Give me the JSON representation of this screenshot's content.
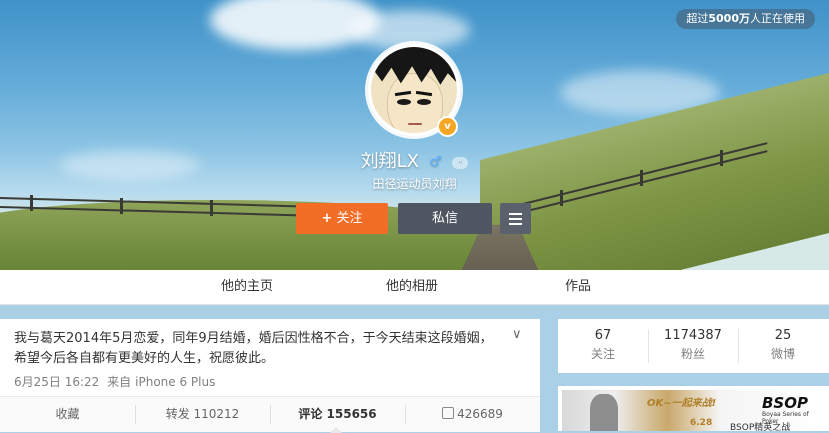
{
  "banner": {
    "usage_prefix": "超过",
    "usage_number": "5000万",
    "usage_suffix": "人正在使用"
  },
  "profile": {
    "name": "刘翔LX",
    "verified_mark": "v",
    "level_mark": "ᐧᐧ",
    "subtitle": "田径运动员刘翔",
    "gender_symbol": "♂"
  },
  "actions": {
    "follow_plus": "+",
    "follow_label": "关注",
    "message_label": "私信"
  },
  "nav": {
    "tabs": [
      {
        "label": "他的主页"
      },
      {
        "label": "他的相册"
      },
      {
        "label": "作品"
      }
    ]
  },
  "post": {
    "text": "我与葛天2014年5月恋爱，同年9月结婚，婚后因性格不合，于今天结束这段婚姻，希望今后各自都有更美好的人生，祝愿彼此。",
    "time": "6月25日 16:22",
    "source_prefix": "来自",
    "source": "iPhone 6 Plus",
    "chevron": "∨",
    "favorite_label": "收藏",
    "repost_label": "转发 110212",
    "comment_label": "评论 155656",
    "like_count": "426689"
  },
  "stats": {
    "items": [
      {
        "value": "67",
        "label": "关注"
      },
      {
        "value": "1174387",
        "label": "粉丝"
      },
      {
        "value": "25",
        "label": "微博"
      }
    ]
  },
  "ad": {
    "slogan": "OK~一起来战!",
    "date": "6.28",
    "tagline": "BSOP精英之战",
    "logo": "BSOP",
    "logo_sub": "Boyaa Series of Poker"
  },
  "colors": {
    "follow_button": "#f26d25",
    "message_button": "#4f5661",
    "verified_badge": "#f5a623",
    "gender_icon": "#5fb0ff"
  },
  "icons": {
    "gender": "male-icon",
    "verified": "verified-badge-icon",
    "menu": "menu-icon",
    "chevron": "chevron-down-icon",
    "like": "thumbs-up-icon"
  }
}
